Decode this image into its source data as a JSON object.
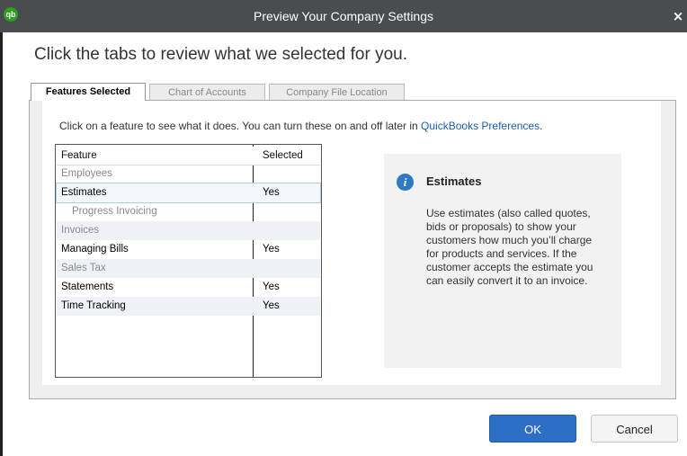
{
  "window": {
    "title": "Preview Your Company Settings",
    "logo_text": "qb",
    "close_glyph": "×"
  },
  "heading": "Click the tabs to review what we selected for you.",
  "tabs": [
    {
      "label": "Features Selected",
      "active": true
    },
    {
      "label": "Chart of Accounts",
      "active": false
    },
    {
      "label": "Company File Location",
      "active": false
    }
  ],
  "intro": {
    "text": "Click on a feature to see what it does. You can turn these on and off later in ",
    "link": "QuickBooks Preferences",
    "suffix": "."
  },
  "table": {
    "headers": {
      "feature": "Feature",
      "selected": "Selected"
    },
    "rows": [
      {
        "feature": "Employees",
        "selected": "",
        "state": "disabled"
      },
      {
        "feature": "Estimates",
        "selected": "Yes",
        "state": "selected"
      },
      {
        "feature": "Progress Invoicing",
        "selected": "",
        "state": "disabled-indent"
      },
      {
        "feature": "Invoices",
        "selected": "",
        "state": "disabled"
      },
      {
        "feature": "Managing Bills",
        "selected": "Yes",
        "state": "normal"
      },
      {
        "feature": "Sales Tax",
        "selected": "",
        "state": "disabled"
      },
      {
        "feature": "Statements",
        "selected": "Yes",
        "state": "normal"
      },
      {
        "feature": "Time Tracking",
        "selected": "Yes",
        "state": "normal"
      }
    ]
  },
  "info": {
    "icon": "info-icon",
    "icon_glyph": "i",
    "title": "Estimates",
    "body": "Use estimates (also called quotes, bids or proposals) to show your customers how much you’ll charge for products and services. If the customer accepts the estimate you can easily convert it to an invoice."
  },
  "buttons": {
    "ok": "OK",
    "cancel": "Cancel"
  },
  "colors": {
    "titlebar": "#4a4c4f",
    "ok_button": "#2d6ec7",
    "link": "#1b5fb3",
    "logo": "#2ca01c"
  }
}
